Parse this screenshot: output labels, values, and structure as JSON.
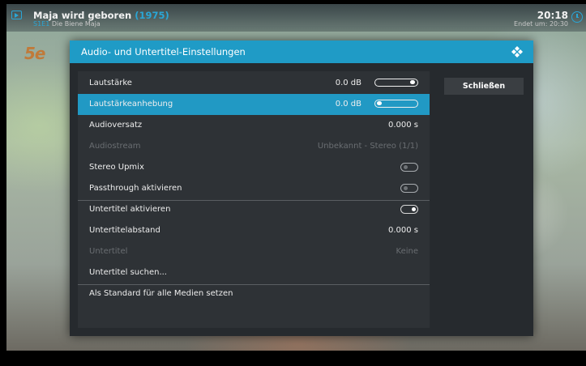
{
  "top_bar": {
    "title": "Maja wird geboren",
    "year": "(1975)",
    "episode_code": "S1E1",
    "episode_title": "Die Biene Maja",
    "clock": "20:18",
    "ends_label": "Endet um: 20:30"
  },
  "channel_logo": "5e",
  "dialog": {
    "title": "Audio- und Untertitel-Einstellungen",
    "close_button": "Schließen",
    "rows": [
      {
        "label": "Lautstärke",
        "value": "0.0 dB",
        "control": "slider",
        "slider_level": 1.0,
        "selected": false,
        "disabled": false
      },
      {
        "label": "Lautstärkeanhebung",
        "value": "0.0 dB",
        "control": "slider",
        "slider_level": 0.0,
        "selected": true,
        "disabled": false
      },
      {
        "label": "Audioversatz",
        "value": "0.000 s",
        "control": "none",
        "selected": false,
        "disabled": false
      },
      {
        "label": "Audiostream",
        "value": "Unbekannt - Stereo (1/1)",
        "control": "none",
        "selected": false,
        "disabled": true
      },
      {
        "label": "Stereo Upmix",
        "value": "",
        "control": "toggle",
        "toggle_on": false,
        "selected": false,
        "disabled": false
      },
      {
        "label": "Passthrough aktivieren",
        "value": "",
        "control": "toggle",
        "toggle_on": false,
        "selected": false,
        "disabled": false
      },
      {
        "label": "Untertitel aktivieren",
        "value": "",
        "control": "toggle",
        "toggle_on": true,
        "selected": false,
        "disabled": false
      },
      {
        "label": "Untertitelabstand",
        "value": "0.000 s",
        "control": "none",
        "selected": false,
        "disabled": false
      },
      {
        "label": "Untertitel",
        "value": "Keine",
        "control": "none",
        "selected": false,
        "disabled": true
      },
      {
        "label": "Untertitel suchen...",
        "value": "",
        "control": "none",
        "selected": false,
        "disabled": false
      },
      {
        "label": "Als Standard für alle Medien setzen",
        "value": "",
        "control": "none",
        "selected": false,
        "disabled": false
      }
    ]
  },
  "colors": {
    "accent": "#2199c4",
    "dialog_bg": "#262a2e",
    "list_bg": "#2e3236"
  }
}
